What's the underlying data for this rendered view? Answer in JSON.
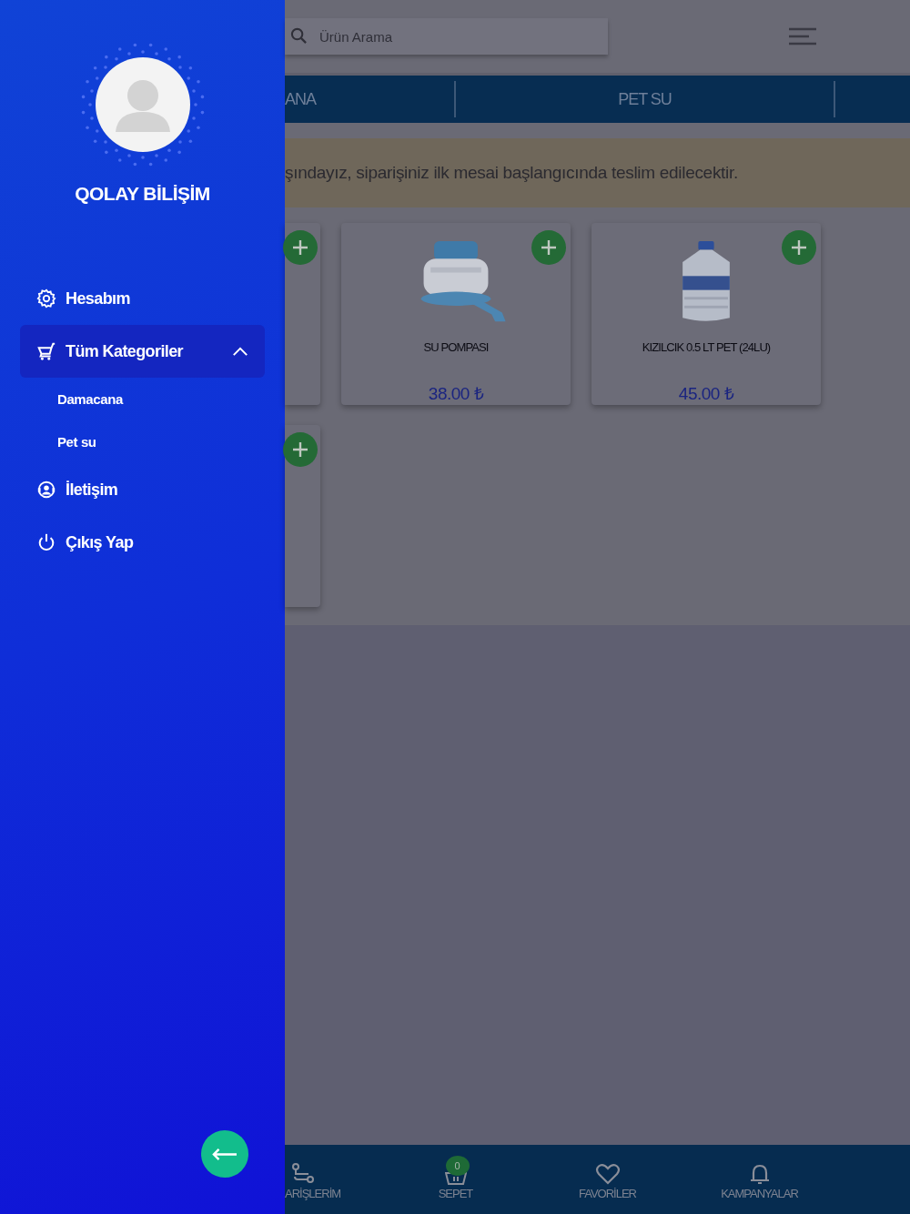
{
  "drawer": {
    "user_name": "QOLAY BİLİŞİM",
    "menu": [
      {
        "kind": "settings",
        "label": "Hesabım"
      },
      {
        "kind": "cart",
        "label": "Tüm Kategoriler",
        "expanded": true,
        "children": [
          {
            "label": "Damacana"
          },
          {
            "label": "Pet su"
          }
        ]
      },
      {
        "kind": "contact",
        "label": "İletişim"
      },
      {
        "kind": "power",
        "label": "Çıkış Yap"
      }
    ]
  },
  "search": {
    "placeholder": "Ürün Arama"
  },
  "tabs": [
    {
      "label": "ANA"
    },
    {
      "label": "PET SU"
    }
  ],
  "notice": "şındayız, siparişiniz ilk mesai başlangıcında teslim edilecektir.",
  "product_rows": [
    [
      {
        "kind": "partial"
      },
      {
        "kind": "full",
        "name": "SU POMPASI",
        "price": "38.00 ₺"
      },
      {
        "kind": "full",
        "name": "KIZILCIK 0.5 LT PET (24LU)",
        "price": "45.00 ₺"
      }
    ],
    [
      {
        "kind": "partial"
      }
    ]
  ],
  "bottom_nav": [
    {
      "kind": "route",
      "label": "ARİŞLERİM"
    },
    {
      "kind": "basket",
      "label": "SEPET",
      "badge": "0"
    },
    {
      "kind": "heart",
      "label": "FAVORİLER"
    },
    {
      "kind": "bell",
      "label": "KAMPANYALAR"
    }
  ]
}
